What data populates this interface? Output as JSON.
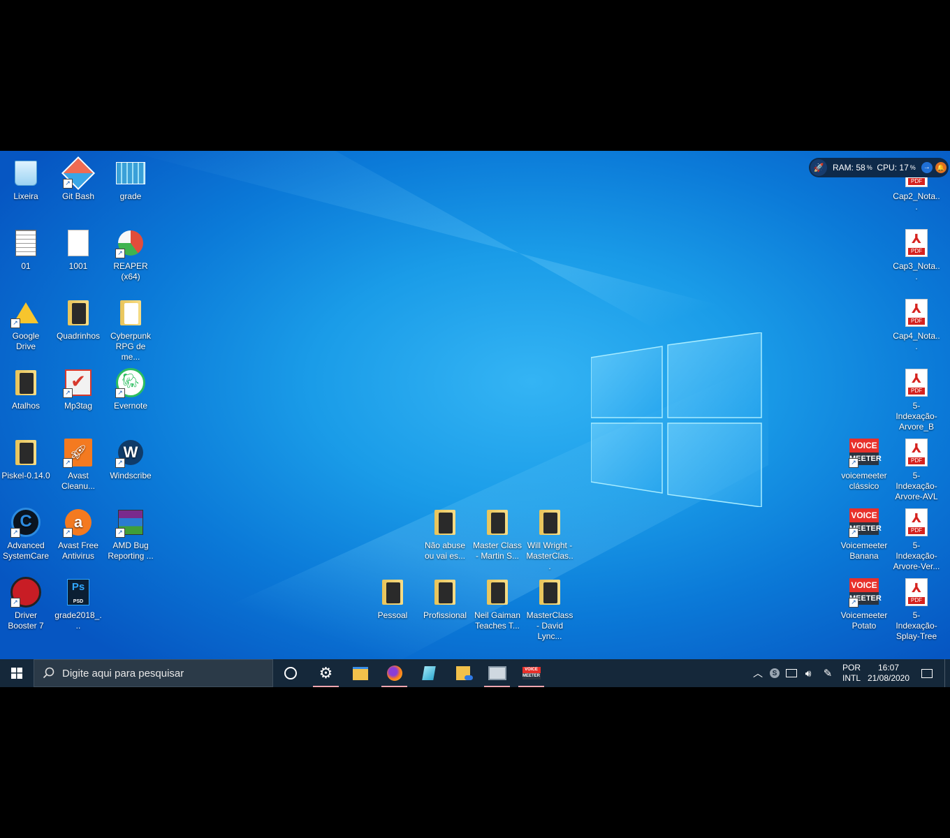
{
  "desktop": {
    "icons": [
      {
        "label": "Lixeira",
        "kind": "recycle-bin"
      },
      {
        "label": "Git Bash",
        "kind": "git-bash"
      },
      {
        "label": "grade",
        "kind": "spreadsheet"
      },
      {
        "label": "01",
        "kind": "table-doc"
      },
      {
        "label": "1001",
        "kind": "text-doc"
      },
      {
        "label": "REAPER (x64)",
        "kind": "reaper"
      },
      {
        "label": "Google Drive",
        "kind": "google-drive"
      },
      {
        "label": "Quadrinhos",
        "kind": "folder"
      },
      {
        "label": "Cyberpunk RPG de me...",
        "kind": "folder-doc"
      },
      {
        "label": "Atalhos",
        "kind": "folder"
      },
      {
        "label": "Mp3tag",
        "kind": "mp3tag"
      },
      {
        "label": "Evernote",
        "kind": "evernote"
      },
      {
        "label": "Piskel-0.14.0",
        "kind": "folder"
      },
      {
        "label": "Avast Cleanu...",
        "kind": "avast-cleanup"
      },
      {
        "label": "Windscribe",
        "kind": "windscribe"
      },
      {
        "label": "Advanced SystemCare",
        "kind": "advanced-systemcare"
      },
      {
        "label": "Avast Free Antivirus",
        "kind": "avast"
      },
      {
        "label": "AMD Bug Reporting ...",
        "kind": "winrar"
      },
      {
        "label": "Driver Booster 7",
        "kind": "driver-booster"
      },
      {
        "label": "grade2018_...",
        "kind": "psd"
      },
      {
        "label": "Não abuse ou vai es...",
        "kind": "folder"
      },
      {
        "label": "Master Class - Martin S...",
        "kind": "folder"
      },
      {
        "label": "Will Wright - MasterClas...",
        "kind": "folder"
      },
      {
        "label": "Pessoal",
        "kind": "folder"
      },
      {
        "label": "Profissional",
        "kind": "folder"
      },
      {
        "label": "Neil Gaiman Teaches T...",
        "kind": "folder"
      },
      {
        "label": "MasterClass - David Lync...",
        "kind": "folder"
      },
      {
        "label": "Cap2_Nota...",
        "kind": "pdf"
      },
      {
        "label": "Cap3_Nota...",
        "kind": "pdf"
      },
      {
        "label": "Cap4_Nota...",
        "kind": "pdf"
      },
      {
        "label": "5-Indexação-Arvore_B",
        "kind": "pdf"
      },
      {
        "label": "voicemeeter clássico",
        "kind": "voicemeeter"
      },
      {
        "label": "5-Indexação-Arvore-AVL",
        "kind": "pdf"
      },
      {
        "label": "Voicemeeter Banana",
        "kind": "voicemeeter"
      },
      {
        "label": "5-Indexação-Arvore-Ver...",
        "kind": "pdf"
      },
      {
        "label": "Voicemeeter Potato",
        "kind": "voicemeeter"
      },
      {
        "label": "5-Indexação-Splay-Tree",
        "kind": "pdf"
      }
    ]
  },
  "voicemeeter_logo": {
    "top": "VOICE",
    "bottom": "MEETER"
  },
  "pdf_tag": "PDF",
  "psd_text": {
    "ps": "Ps",
    "psd": "PSD"
  },
  "system_monitor": {
    "ram_label": "RAM:",
    "ram_value": "58",
    "cpu_label": "CPU:",
    "cpu_value": "17",
    "unit": "%"
  },
  "taskbar": {
    "search_placeholder": "Digite aqui para pesquisar",
    "apps": [
      "settings",
      "file-explorer",
      "firefox",
      "notepad",
      "onedrive-folder",
      "remote-desktop",
      "voicemeeter"
    ],
    "tray": {
      "language": "POR",
      "layout": "INTL",
      "time": "16:07",
      "date": "21/08/2020"
    }
  },
  "colors": {
    "accent_underline": "#f0a6b0",
    "taskbar": "#15283a",
    "pdf_red": "#d6221e"
  }
}
